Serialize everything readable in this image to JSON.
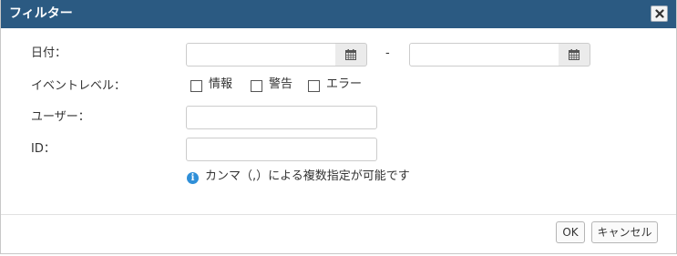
{
  "dialog": {
    "title": "フィルター",
    "close_icon": "close-icon"
  },
  "form": {
    "date": {
      "label": "日付：",
      "from_value": "",
      "to_value": "",
      "separator": "-",
      "icon": "calendar-icon"
    },
    "event_level": {
      "label": "イベントレベル：",
      "options": [
        {
          "label": "情報",
          "checked": false
        },
        {
          "label": "警告",
          "checked": false
        },
        {
          "label": "エラー",
          "checked": false
        }
      ]
    },
    "user": {
      "label": "ユーザー：",
      "value": ""
    },
    "id": {
      "label": "ID：",
      "value": "",
      "hint": "カンマ（,）による複数指定が可能です",
      "hint_icon": "info-icon"
    }
  },
  "footer": {
    "ok_label": "OK",
    "cancel_label": "キャンセル"
  },
  "colors": {
    "titlebar": "#2b5a82",
    "info": "#2f8fd8"
  }
}
